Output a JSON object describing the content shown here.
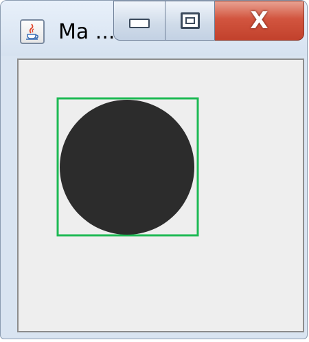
{
  "window": {
    "title": "Ma ...",
    "app_icon": "java-cup-icon",
    "controls": {
      "minimize_icon": "minimize-icon",
      "maximize_icon": "maximize-icon",
      "close_label": "X"
    }
  },
  "drawing": {
    "shapes": [
      {
        "kind": "square-outline",
        "color": "#1db954"
      },
      {
        "kind": "filled-circle",
        "color": "#2c2c2c"
      }
    ]
  }
}
